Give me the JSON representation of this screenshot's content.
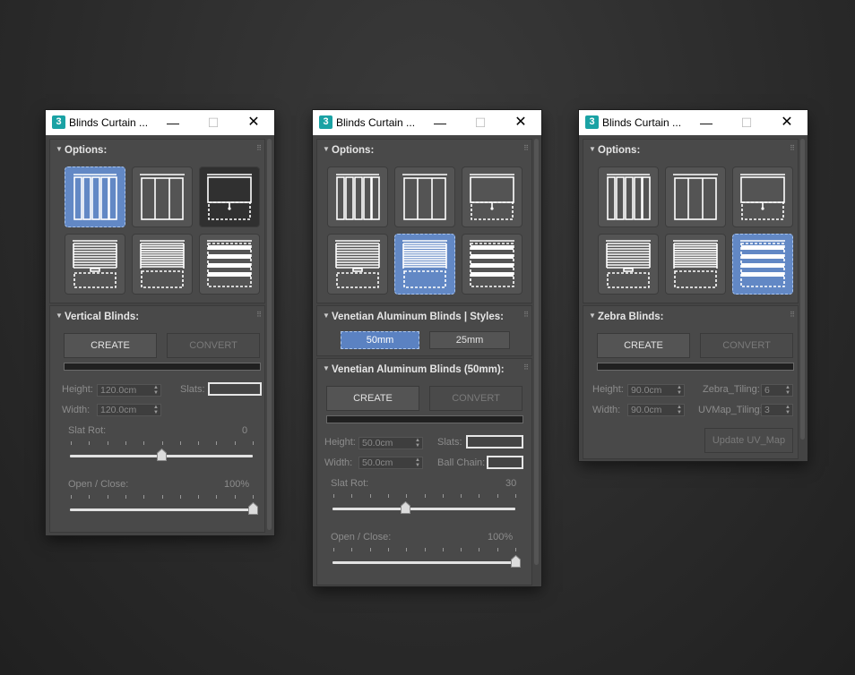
{
  "app": {
    "title": "Blinds Curtain ...",
    "icon_glyph": "3",
    "min_icon": "minimize-icon",
    "max_icon": "maximize-icon",
    "close_icon": "close-icon"
  },
  "options_title": "Options:",
  "tile_icons": [
    "vertical-blinds-icon",
    "panel-blinds-icon",
    "roller-blinds-icon",
    "venetian-blinds-50mm-icon",
    "venetian-blinds-25mm-icon",
    "zebra-blinds-icon"
  ],
  "colors": {
    "accent": "#6288c5",
    "panel": "#494949",
    "background": "#2d2d2d"
  },
  "left": {
    "section_title": "Vertical Blinds:",
    "create": "CREATE",
    "convert": "CONVERT",
    "height_label": "Height:",
    "height_value": "120.0cm",
    "width_label": "Width:",
    "width_value": "120.0cm",
    "slats_label": "Slats:",
    "slat_rot_label": "Slat Rot:",
    "slat_rot_value": "0",
    "open_close_label": "Open / Close:",
    "open_close_value": "100%",
    "slat_rot_fraction": 0.5,
    "open_close_fraction": 1.0
  },
  "middle": {
    "styles_title": "Venetian Aluminum Blinds | Styles:",
    "style_50": "50mm",
    "style_25": "25mm",
    "section_title": "Venetian Aluminum Blinds (50mm):",
    "create": "CREATE",
    "convert": "CONVERT",
    "height_label": "Height:",
    "height_value": "50.0cm",
    "width_label": "Width:",
    "width_value": "50.0cm",
    "slats_label": "Slats:",
    "ball_chain_label": "Ball Chain:",
    "slat_rot_label": "Slat Rot:",
    "slat_rot_value": "30",
    "open_close_label": "Open / Close:",
    "open_close_value": "100%",
    "slat_rot_fraction": 0.4,
    "open_close_fraction": 1.0
  },
  "right": {
    "section_title": "Zebra Blinds:",
    "create": "CREATE",
    "convert": "CONVERT",
    "height_label": "Height:",
    "height_value": "90.0cm",
    "width_label": "Width:",
    "width_value": "90.0cm",
    "zebra_tiling_label": "Zebra_Tiling:",
    "zebra_tiling_value": "6",
    "uvmap_tiling_label": "UVMap_Tiling:",
    "uvmap_tiling_value": "3",
    "update_uv": "Update UV_Map"
  }
}
